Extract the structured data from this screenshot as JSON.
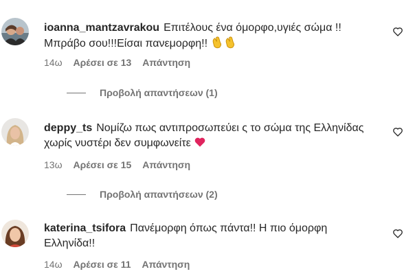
{
  "comments": [
    {
      "username": "ioanna_mantzavrakou",
      "text": "Επιτέλους ένα όμορφο,υγιές σώμα !! Μπράβο σου!!!Είσαι πανεμορφη!!",
      "emoji": "clapping-hands",
      "time": "14ω",
      "likes": "Αρέσει σε 13",
      "reply_label": "Απάντηση",
      "view_replies": "Προβολή απαντήσεων (1)"
    },
    {
      "username": "deppy_ts",
      "text": "Νομίζω πως αντιπροσωπεύει ς το σώμα της Ελληνίδας χωρίς νυστέρι δεν συμφωνείτε",
      "emoji": "red-heart",
      "time": "13ω",
      "likes": "Αρέσει σε 15",
      "reply_label": "Απάντηση",
      "view_replies": "Προβολή απαντήσεων (2)"
    },
    {
      "username": "katerina_tsifora",
      "text": "Πανέμορφη όπως πάντα!! Η πιο όμορφη Ελληνίδα!!",
      "time": "14ω",
      "likes": "Αρέσει σε 11",
      "reply_label": "Απάντηση"
    }
  ],
  "icons": {
    "like": "heart-outline-icon"
  },
  "colors": {
    "text": "#262626",
    "secondary": "#737373",
    "heart": "#e0245e"
  }
}
